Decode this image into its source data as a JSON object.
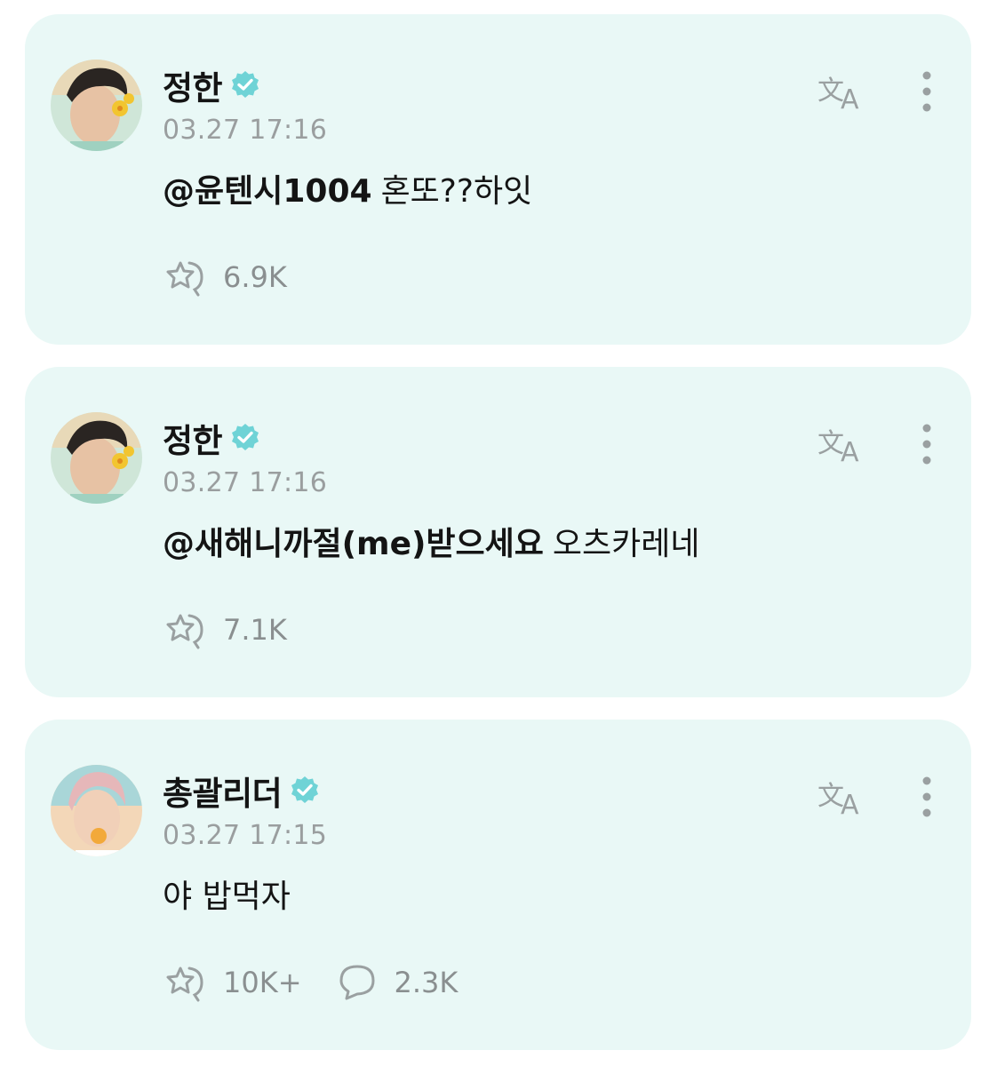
{
  "colors": {
    "card_background": "#e9f8f6",
    "verified_badge": "#6fd3d6",
    "icon_gray": "#9aa0a1",
    "text_primary": "#141414",
    "text_secondary": "#9a9e9f"
  },
  "posts": [
    {
      "author": "정한",
      "verified": true,
      "timestamp": "03.27 17:16",
      "mention": "@윤텐시1004",
      "text": "혼또??하잇",
      "icons": [
        "translate-icon",
        "more-options-icon"
      ],
      "reactions": {
        "icon": "reaction-icon",
        "count": "6.9K"
      }
    },
    {
      "author": "정한",
      "verified": true,
      "timestamp": "03.27 17:16",
      "mention": "@새해니까절(me)받으세요",
      "text": "오츠카레네",
      "icons": [
        "translate-icon",
        "more-options-icon"
      ],
      "reactions": {
        "icon": "reaction-icon",
        "count": "7.1K"
      }
    },
    {
      "author": "총괄리더",
      "verified": true,
      "timestamp": "03.27 17:15",
      "mention": "",
      "text": "야 밥먹자",
      "icons": [
        "translate-icon",
        "more-options-icon"
      ],
      "reactions": {
        "icon": "reaction-icon",
        "count": "10K+"
      },
      "comments": {
        "icon": "comment-icon",
        "count": "2.3K"
      }
    }
  ]
}
